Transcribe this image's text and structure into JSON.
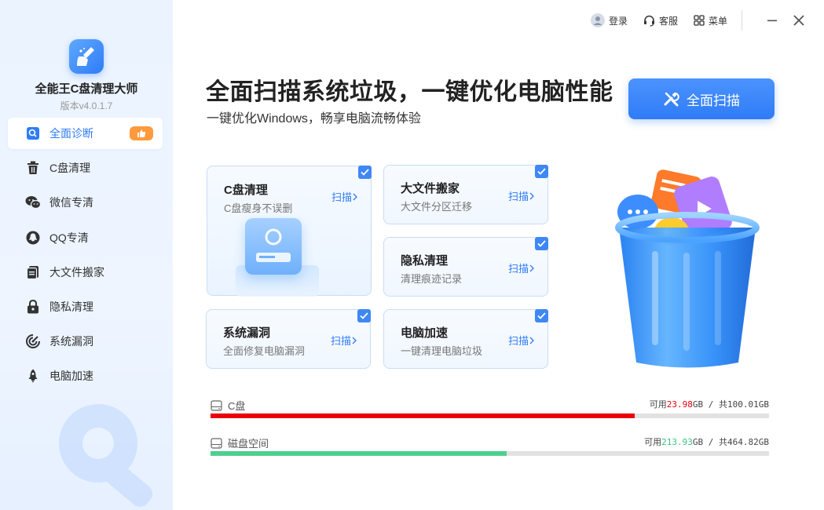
{
  "app": {
    "name": "全能王C盘清理大师",
    "version": "版本v4.0.1.7"
  },
  "titlebar": {
    "login": "登录",
    "service": "客服",
    "menu": "菜单"
  },
  "sidebar": {
    "items": [
      {
        "label": "全面诊断",
        "icon": "diagnosis-icon",
        "active": true,
        "badge": "thumbs-up-icon"
      },
      {
        "label": "C盘清理",
        "icon": "trash-icon"
      },
      {
        "label": "微信专清",
        "icon": "wechat-icon"
      },
      {
        "label": "QQ专清",
        "icon": "qq-icon"
      },
      {
        "label": "大文件搬家",
        "icon": "files-icon"
      },
      {
        "label": "隐私清理",
        "icon": "lock-icon"
      },
      {
        "label": "系统漏洞",
        "icon": "shield-scan-icon"
      },
      {
        "label": "电脑加速",
        "icon": "rocket-icon"
      }
    ]
  },
  "hero": {
    "title": "全面扫描系统垃圾，一键优化电脑性能",
    "subtitle": "一键优化Windows，畅享电脑流畅体验",
    "scan_button": "全面扫描"
  },
  "cards": {
    "cclean": {
      "title": "C盘清理",
      "desc": "C盘瘦身不误删",
      "action": "扫描",
      "checked": true
    },
    "bigfile": {
      "title": "大文件搬家",
      "desc": "大文件分区迁移",
      "action": "扫描",
      "checked": true
    },
    "privacy": {
      "title": "隐私清理",
      "desc": "清理痕迹记录",
      "action": "扫描",
      "checked": true
    },
    "vuln": {
      "title": "系统漏洞",
      "desc": "全面修复电脑漏洞",
      "action": "扫描",
      "checked": true
    },
    "speed": {
      "title": "电脑加速",
      "desc": "一键清理电脑垃圾",
      "action": "扫描",
      "checked": true
    }
  },
  "disks": [
    {
      "label": "C盘",
      "avail_prefix": "可用",
      "avail": "23.98",
      "total_text": "GB / 共100.01GB",
      "used_fraction": 0.76,
      "color": "#e8000b",
      "avail_color": "#e8000b"
    },
    {
      "label": "磁盘空间",
      "avail_prefix": "可用",
      "avail": "213.93",
      "total_text": "GB / 共464.82GB",
      "used_fraction": 0.53,
      "color": "#4fcf8f",
      "avail_color": "#3cc07f"
    }
  ],
  "colors": {
    "accent": "#2f7cf6",
    "sidebar_bg": "#eaf3ff"
  }
}
